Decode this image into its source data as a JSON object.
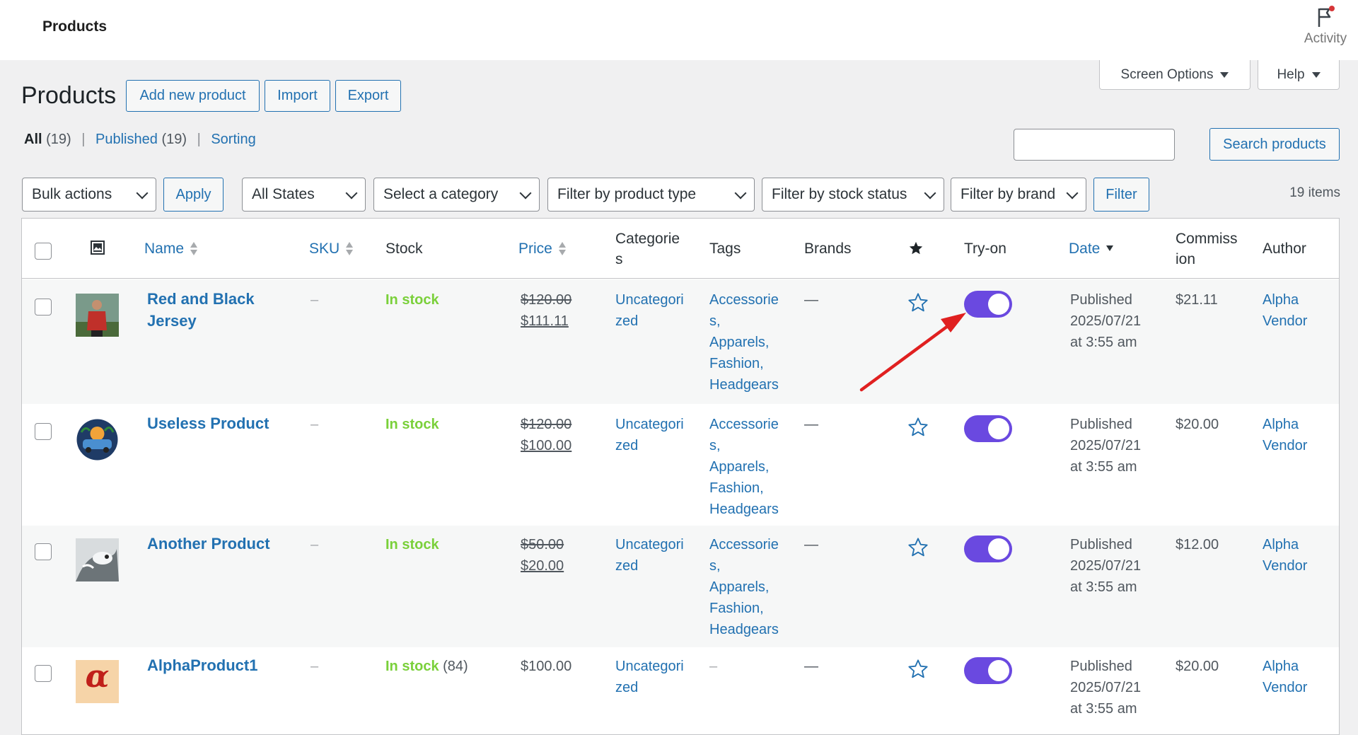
{
  "topbar": {
    "title": "Products",
    "activity_label": "Activity"
  },
  "screen_meta": {
    "screen_options_label": "Screen Options",
    "help_label": "Help"
  },
  "page": {
    "title": "Products",
    "add_new_label": "Add new product",
    "import_label": "Import",
    "export_label": "Export"
  },
  "views": [
    {
      "label": "All",
      "count": "(19)"
    },
    {
      "label": "Published",
      "count": "(19)"
    },
    {
      "label": "Sorting",
      "count": ""
    }
  ],
  "search": {
    "value": "",
    "button_label": "Search products"
  },
  "filters": {
    "bulk_actions": "Bulk actions",
    "apply_label": "Apply",
    "states": "All States",
    "category": "Select a category",
    "product_type": "Filter by product type",
    "stock_status": "Filter by stock status",
    "brand": "Filter by brand",
    "filter_label": "Filter",
    "items_count": "19 items"
  },
  "columns": {
    "name": "Name",
    "sku": "SKU",
    "stock": "Stock",
    "price": "Price",
    "categories_1": "Categorie",
    "categories_2": "s",
    "tags": "Tags",
    "brands": "Brands",
    "tryon": "Try-on",
    "date": "Date",
    "commission_1": "Commiss",
    "commission_2": "ion",
    "author": "Author"
  },
  "rows": [
    {
      "name_1": "Red and Black",
      "name_2": "Jersey",
      "sku": "–",
      "stock": "In stock",
      "stock_qty": "",
      "regular_price": "$120.00",
      "sale_price": "$111.11",
      "cat_1": "Uncategori",
      "cat_2": "zed",
      "tags": [
        "Accessorie",
        "s,",
        "Apparels,",
        "Fashion,",
        "Headgears"
      ],
      "brand": "—",
      "date_1": "Published",
      "date_2": "2025/07/21",
      "date_3": "at 3:55 am",
      "commission": "$21.11",
      "author_1": "Alpha",
      "author_2": "Vendor",
      "tryon_on": true
    },
    {
      "name_1": "Useless Product",
      "name_2": "",
      "sku": "–",
      "stock": "In stock",
      "stock_qty": "",
      "regular_price": "$120.00",
      "sale_price": "$100.00",
      "cat_1": "Uncategori",
      "cat_2": "zed",
      "tags": [
        "Accessorie",
        "s,",
        "Apparels,",
        "Fashion,",
        "Headgears"
      ],
      "brand": "—",
      "date_1": "Published",
      "date_2": "2025/07/21",
      "date_3": "at 3:55 am",
      "commission": "$20.00",
      "author_1": "Alpha",
      "author_2": "Vendor",
      "tryon_on": true
    },
    {
      "name_1": "Another Product",
      "name_2": "",
      "sku": "–",
      "stock": "In stock",
      "stock_qty": "",
      "regular_price": "$50.00",
      "sale_price": "$20.00",
      "cat_1": "Uncategori",
      "cat_2": "zed",
      "tags": [
        "Accessorie",
        "s,",
        "Apparels,",
        "Fashion,",
        "Headgears"
      ],
      "brand": "—",
      "date_1": "Published",
      "date_2": "2025/07/21",
      "date_3": "at 3:55 am",
      "commission": "$12.00",
      "author_1": "Alpha",
      "author_2": "Vendor",
      "tryon_on": true
    },
    {
      "name_1": "AlphaProduct1",
      "name_2": "",
      "sku": "–",
      "stock": "In stock",
      "stock_qty": "(84)",
      "price": "$100.00",
      "cat_1": "Uncategori",
      "cat_2": "zed",
      "tags": [
        "–"
      ],
      "brand": "—",
      "date_1": "Published",
      "date_2": "2025/07/21",
      "date_3": "at 3:55 am",
      "commission": "$20.00",
      "author_1": "Alpha",
      "author_2": "Vendor",
      "tryon_on": true,
      "thumb_letter": "α"
    }
  ],
  "colors": {
    "accent": "#2271b1",
    "toggle": "#6a49e0",
    "in_stock": "#7ad03a",
    "annotation": "#e02020"
  }
}
